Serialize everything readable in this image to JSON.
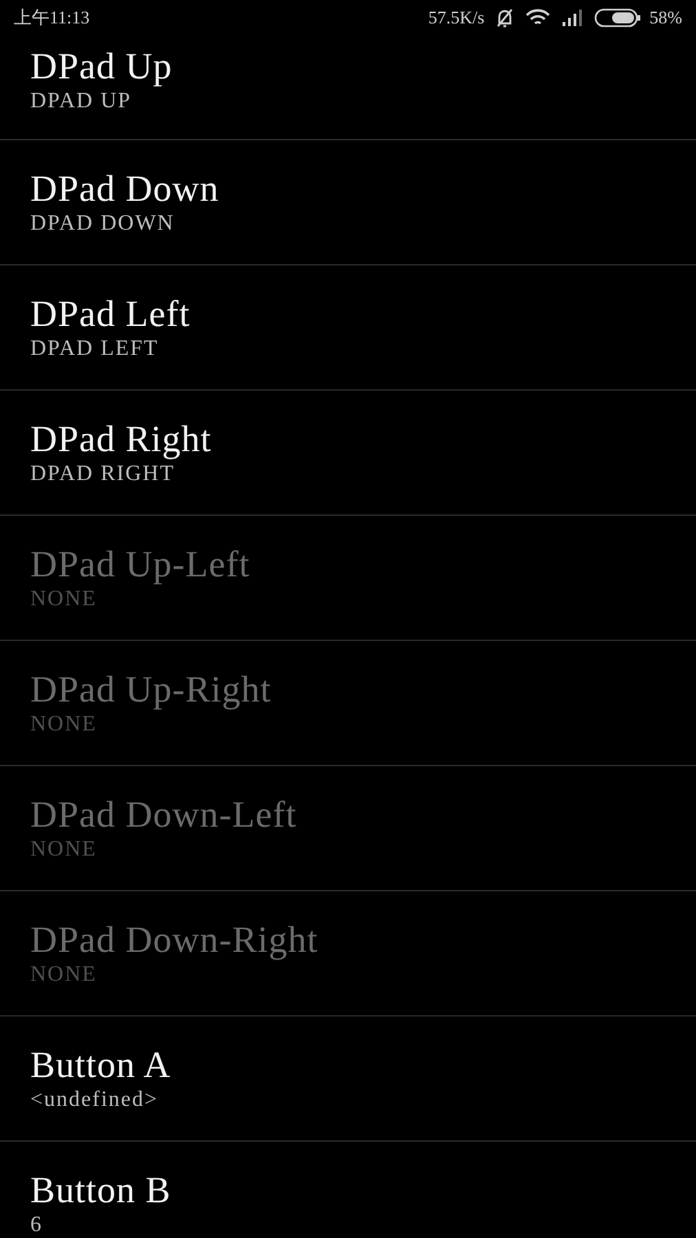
{
  "status_bar": {
    "time": "上午11:13",
    "speed": "57.5K/s",
    "battery": "58%"
  },
  "items": [
    {
      "title": "DPad Up",
      "summary": "DPAD UP",
      "enabled": true
    },
    {
      "title": "DPad Down",
      "summary": "DPAD DOWN",
      "enabled": true
    },
    {
      "title": "DPad Left",
      "summary": "DPAD LEFT",
      "enabled": true
    },
    {
      "title": "DPad Right",
      "summary": "DPAD RIGHT",
      "enabled": true
    },
    {
      "title": "DPad Up-Left",
      "summary": "NONE",
      "enabled": false
    },
    {
      "title": "DPad Up-Right",
      "summary": "NONE",
      "enabled": false
    },
    {
      "title": "DPad Down-Left",
      "summary": "NONE",
      "enabled": false
    },
    {
      "title": "DPad Down-Right",
      "summary": "NONE",
      "enabled": false
    },
    {
      "title": "Button A",
      "summary": "<undefined>",
      "enabled": true
    },
    {
      "title": "Button B",
      "summary": "6",
      "enabled": true
    }
  ]
}
